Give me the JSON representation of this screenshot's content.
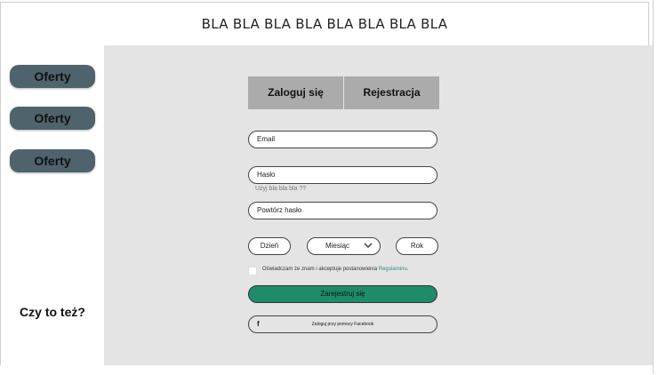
{
  "header": {
    "title": "BLA BLA BLA BLA BLA BLA BLA BLA"
  },
  "sidebar": {
    "items": [
      {
        "label": "Oferty"
      },
      {
        "label": "Oferty"
      },
      {
        "label": "Oferty"
      }
    ],
    "question": "Czy to też?"
  },
  "tabs": {
    "login": "Zaloguj się",
    "register": "Rejestracja"
  },
  "form": {
    "email_placeholder": "Email",
    "password_placeholder": "Hasło",
    "password_hint": "Użyj bla bla bla ??",
    "repeat_password_placeholder": "Powtórz hasło",
    "day": "Dzień",
    "month": "Miesiąc",
    "year": "Rok",
    "consent_text": "Oświadczam że znam i akceptuje postanowienia",
    "consent_link": "Regulaminu",
    "consent_dot": ".",
    "submit_label": "Zarejestruj się",
    "facebook_label": "Zaloguj przy pomocy Facebook",
    "facebook_icon_glyph": "f"
  },
  "colors": {
    "sidebar_button": "#4e636b",
    "submit": "#1e8b6b",
    "tab": "#ababab",
    "link": "#3a8a84"
  }
}
